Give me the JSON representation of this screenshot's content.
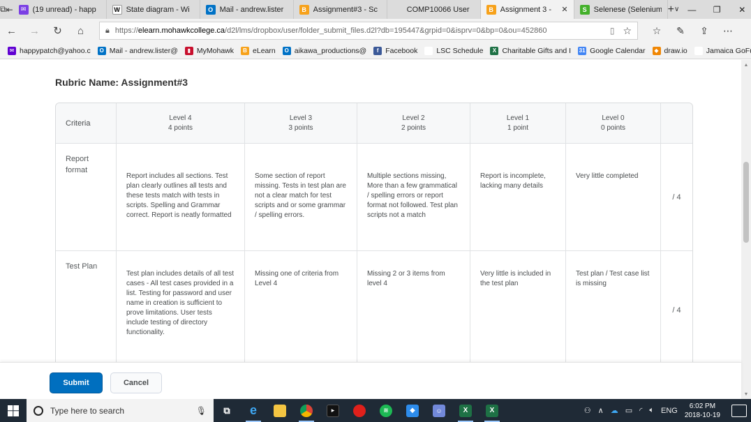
{
  "browser": {
    "tabs": [
      {
        "title": "(19 unread) - happ",
        "icon": "yahoo-mail-icon",
        "color": "#7b3fe4",
        "glyph": "✉"
      },
      {
        "title": "State diagram - Wi",
        "icon": "wikipedia-icon",
        "color": "#ffffff",
        "glyph": "W"
      },
      {
        "title": "Mail - andrew.lister",
        "icon": "outlook-icon",
        "color": "#0072c6",
        "glyph": "O"
      },
      {
        "title": "Assignment#3 - Sc",
        "icon": "brightspace-icon",
        "color": "#f7a21b",
        "glyph": "B"
      },
      {
        "title": "COMP10066 User",
        "icon": "blank-page-icon",
        "color": "#dcdcdc",
        "glyph": ""
      },
      {
        "title": "Assignment 3 -",
        "icon": "brightspace-icon",
        "color": "#f7a21b",
        "glyph": "B"
      },
      {
        "title": "Selenese (Selenium",
        "icon": "selenium-icon",
        "color": "#43b02a",
        "glyph": "S"
      }
    ],
    "address_bar": {
      "prefix": "https://",
      "host": "elearn.mohawkcollege.ca",
      "path": "/d2l/lms/dropbox/user/folder_submit_files.d2l?db=195447&grpid=0&isprv=0&bp=0&ou=452860"
    },
    "favorites": [
      {
        "label": "happypatch@yahoo.c",
        "color": "#6001d2",
        "glyph": "✉"
      },
      {
        "label": "Mail - andrew.lister@",
        "color": "#0072c6",
        "glyph": "O"
      },
      {
        "label": "MyMohawk",
        "color": "#c8102e",
        "glyph": "▮"
      },
      {
        "label": "eLearn",
        "color": "#f7a21b",
        "glyph": "B"
      },
      {
        "label": "aikawa_productions@",
        "color": "#0072c6",
        "glyph": "O"
      },
      {
        "label": "Facebook",
        "color": "#3b5998",
        "glyph": "f"
      },
      {
        "label": "LSC Schedule",
        "color": "#ffffff",
        "glyph": ""
      },
      {
        "label": "Charitable Gifts and I",
        "color": "#1e7145",
        "glyph": "X"
      },
      {
        "label": "Google Calendar",
        "color": "#4285f4",
        "glyph": "31"
      },
      {
        "label": "draw.io",
        "color": "#f08705",
        "glyph": "◆"
      },
      {
        "label": "Jamaica GoFundMe",
        "color": "#ffffff",
        "glyph": ""
      }
    ]
  },
  "page": {
    "rubric_title": "Rubric Name: Assignment#3",
    "criteria_header": "Criteria",
    "levels": [
      {
        "name": "Level 4",
        "points": "4 points"
      },
      {
        "name": "Level 3",
        "points": "3 points"
      },
      {
        "name": "Level 2",
        "points": "2 points"
      },
      {
        "name": "Level 1",
        "points": "1 point"
      },
      {
        "name": "Level 0",
        "points": "0 points"
      }
    ],
    "rows": [
      {
        "criterion": "Report format",
        "cells": [
          "Report includes all sections.  Test plan clearly outlines all tests and these tests match with tests in scripts.  Spelling and Grammar correct.  Report is neatly formatted",
          "Some section of report missing.  Tests in test plan are not a clear match for test scripts and or some grammar / spelling errors.",
          "Multiple sections missing, More than a few grammatical / spelling errors or report format not followed.  Test plan scripts not a match",
          "Report is incomplete, lacking many details",
          "Very little completed"
        ],
        "score": "/ 4"
      },
      {
        "criterion": "Test Plan",
        "cells": [
          "Test plan includes details of all test cases - All test cases provided in a list.  Testing for password and user name in creation is sufficient to prove limitations.  User tests include testing of directory functionality.",
          "Missing one of criteria from Level 4",
          "Missing 2 or 3 items from level 4",
          "Very little is included in the test plan",
          "Test plan / Test case list is missing"
        ],
        "score": "/ 4"
      }
    ],
    "submit_label": "Submit",
    "cancel_label": "Cancel"
  },
  "taskbar": {
    "search_placeholder": "Type here to search",
    "language": "ENG",
    "time": "6:02 PM",
    "date": "2018-10-19"
  }
}
